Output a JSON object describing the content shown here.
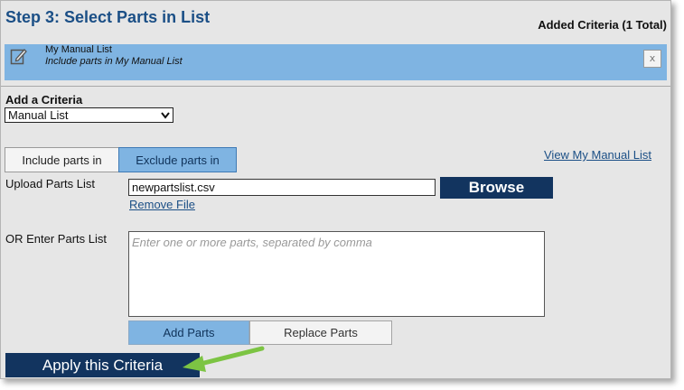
{
  "header": {
    "title": "Step 3: Select Parts in List",
    "added_criteria": "Added Criteria (1 Total)"
  },
  "criteria": [
    {
      "name": "My Manual List",
      "description": "Include parts in My Manual List",
      "remove": "x"
    }
  ],
  "add_criteria": {
    "label": "Add a Criteria",
    "selected": "Manual List"
  },
  "mode_tabs": {
    "include": "Include parts in",
    "exclude": "Exclude parts in",
    "active": "exclude"
  },
  "view_link": "View My Manual List",
  "upload": {
    "label": "Upload Parts List",
    "filename": "newpartslist.csv",
    "browse": "Browse",
    "remove": "Remove File"
  },
  "enter": {
    "label": "OR Enter Parts List",
    "placeholder": "Enter one or more parts, separated by comma"
  },
  "actions": {
    "add": "Add Parts",
    "replace": "Replace Parts",
    "apply": "Apply this Criteria"
  },
  "colors": {
    "accent": "#7fb4e2",
    "dark_button": "#12345f",
    "title": "#1b4f86",
    "arrow": "#7cc443"
  },
  "icons": {
    "criteria": "edit-note-icon",
    "select": "chevron-down-icon",
    "annotation": "arrow-icon"
  }
}
